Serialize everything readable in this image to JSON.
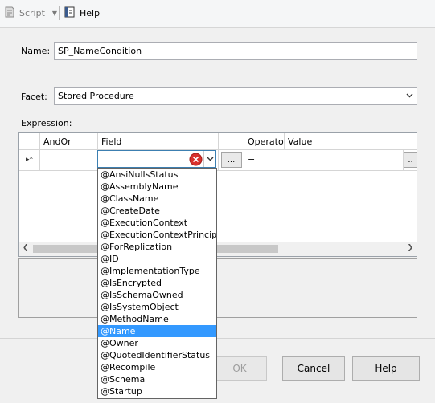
{
  "toolbar": {
    "script_label": "Script",
    "help_label": "Help"
  },
  "form": {
    "name_label": "Name:",
    "name_value": "SP_NameCondition",
    "facet_label": "Facet:",
    "facet_value": "Stored Procedure",
    "expression_label": "Expression:"
  },
  "grid": {
    "columns": [
      "AndOr",
      "Field",
      "Operato",
      "Value"
    ],
    "row": {
      "indicator": "▸*",
      "andor": "",
      "field": "",
      "operator": "=",
      "value": "",
      "ellipsis": "..."
    }
  },
  "dropdown": {
    "items": [
      "@AnsiNullsStatus",
      "@AssemblyName",
      "@ClassName",
      "@CreateDate",
      "@ExecutionContext",
      "@ExecutionContextPrincipa",
      "@ForReplication",
      "@ID",
      "@ImplementationType",
      "@IsEncrypted",
      "@IsSchemaOwned",
      "@IsSystemObject",
      "@MethodName",
      "@Name",
      "@Owner",
      "@QuotedIdentifierStatus",
      "@Recompile",
      "@Schema",
      "@Startup"
    ],
    "selected": "@Name"
  },
  "buttons": {
    "ok": "OK",
    "cancel": "Cancel",
    "help": "Help"
  },
  "colors": {
    "selection": "#3399ff",
    "window_bg": "#f0f0f0"
  }
}
